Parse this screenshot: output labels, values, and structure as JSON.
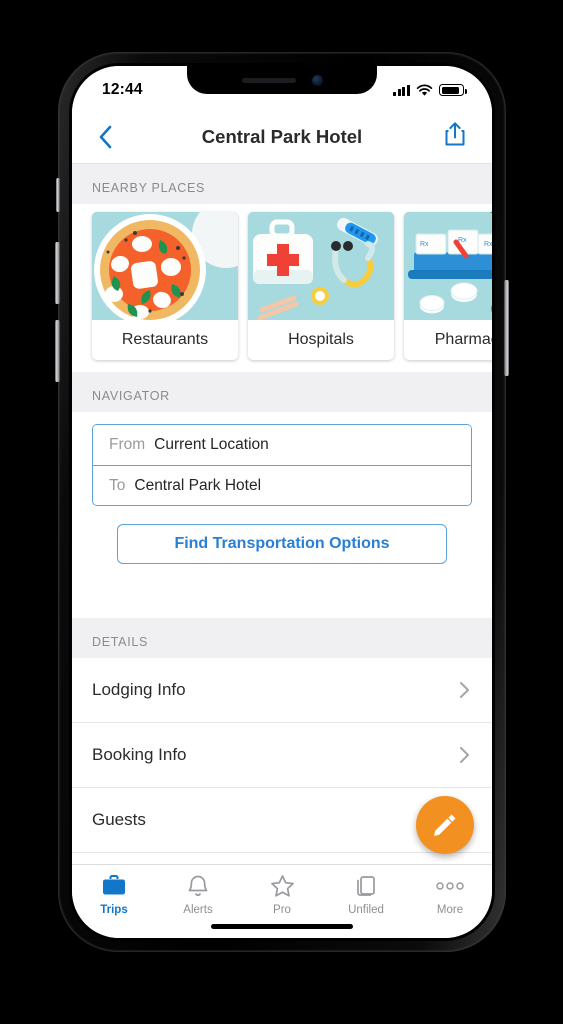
{
  "status_bar": {
    "time": "12:44",
    "signal_icon": "cellular-signal-icon",
    "wifi_icon": "wifi-icon",
    "battery_icon": "battery-icon"
  },
  "nav_bar": {
    "back_icon": "chevron-left-icon",
    "title": "Central Park Hotel",
    "share_icon": "share-icon"
  },
  "nearby_places": {
    "header": "NEARBY PLACES",
    "cards": [
      {
        "label": "Restaurants",
        "art": "pizza-illustration"
      },
      {
        "label": "Hospitals",
        "art": "first-aid-illustration"
      },
      {
        "label": "Pharmacies",
        "art": "pills-illustration"
      }
    ]
  },
  "navigator": {
    "header": "NAVIGATOR",
    "from_label": "From",
    "from_value": "Current Location",
    "to_label": "To",
    "to_value": "Central Park Hotel",
    "cta_label": "Find Transportation Options"
  },
  "details": {
    "header": "DETAILS",
    "rows": [
      {
        "label": "Lodging Info",
        "chevron": "chevron-right-icon"
      },
      {
        "label": "Booking Info",
        "chevron": "chevron-right-icon"
      },
      {
        "label": "Guests",
        "chevron": ""
      }
    ]
  },
  "fab": {
    "icon": "pencil-edit-icon"
  },
  "tab_bar": {
    "tabs": [
      {
        "label": "Trips",
        "icon": "briefcase-icon",
        "active": true
      },
      {
        "label": "Alerts",
        "icon": "bell-icon",
        "active": false
      },
      {
        "label": "Pro",
        "icon": "star-icon",
        "active": false
      },
      {
        "label": "Unfiled",
        "icon": "documents-icon",
        "active": false
      },
      {
        "label": "More",
        "icon": "ellipsis-icon",
        "active": false
      }
    ]
  },
  "colors": {
    "accent_blue": "#1277c9",
    "link_blue": "#2a7fd4",
    "fab_orange": "#f29121",
    "section_bg": "#f0f0f3",
    "card_art_bg": "#a7dade"
  }
}
